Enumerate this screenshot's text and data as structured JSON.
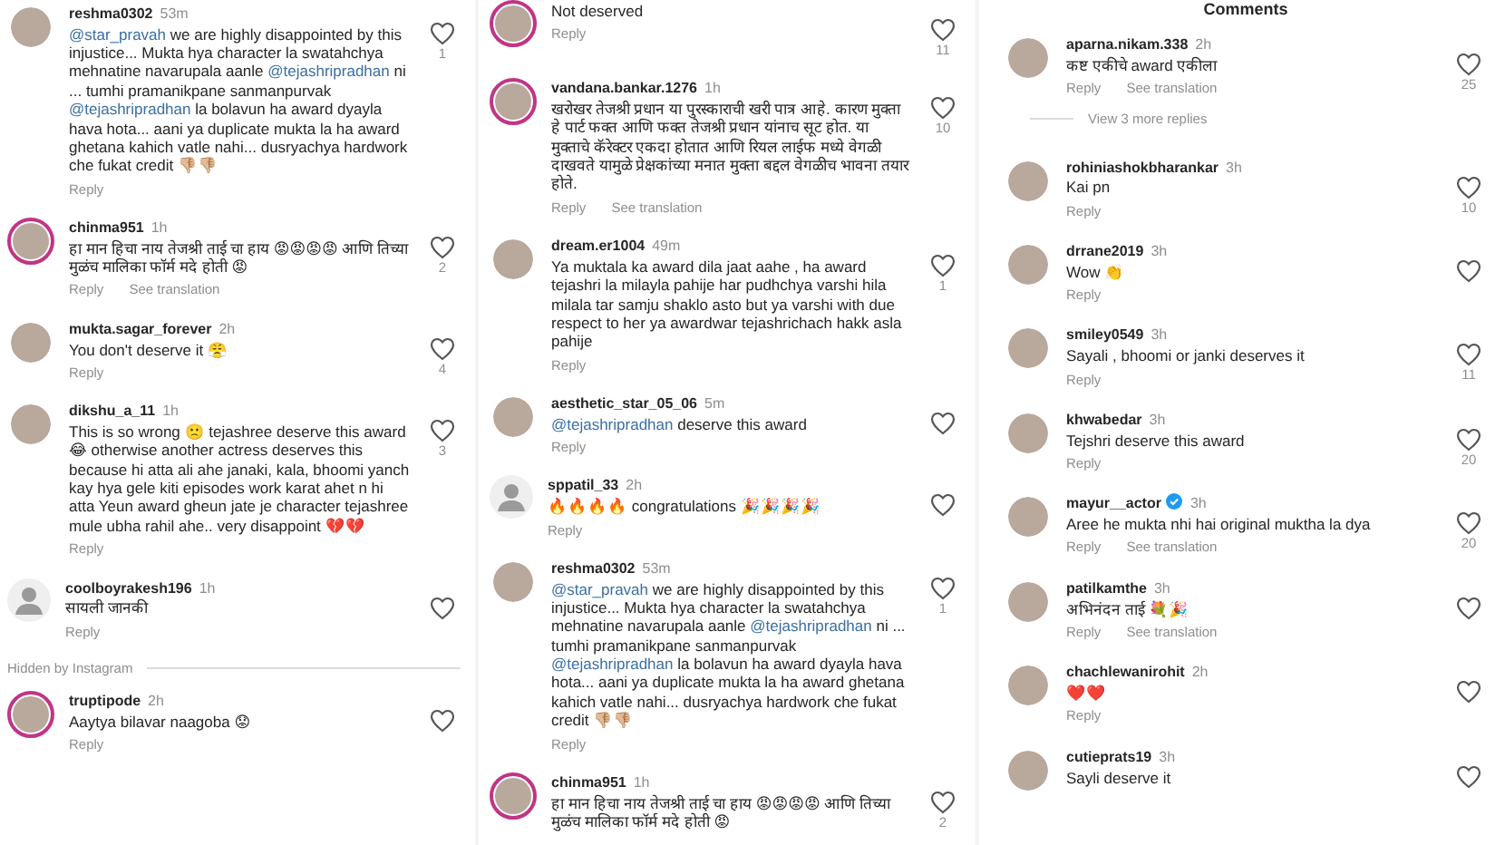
{
  "columns": [
    {
      "items": [
        {
          "kind": "comment",
          "username": "reshma0302",
          "time": "53m",
          "default_avatar": false,
          "story_ring": false,
          "verified": false,
          "segments": [
            {
              "kind": "mention",
              "text": "@star_pravah"
            },
            {
              "kind": "plain",
              "text": " we are highly disappointed by this injustice... Mukta hya character la swatahchya mehnatine navarupala aanle "
            },
            {
              "kind": "mention",
              "text": "@tejashripradhan"
            },
            {
              "kind": "plain",
              "text": " ni ... tumhi pramanikpane sanmanpurvak "
            },
            {
              "kind": "mention",
              "text": "@tejashripradhan"
            },
            {
              "kind": "plain",
              "text": " la bolavun ha award dyayla hava hota... aani ya duplicate mukta la ha award ghetana kahich vatle nahi... dusryachya hardwork che fukat credit 👎🏼👎🏼"
            }
          ],
          "actions": [
            "Reply"
          ],
          "likes": "1"
        },
        {
          "kind": "comment",
          "username": "chinma951",
          "time": "1h",
          "default_avatar": false,
          "story_ring": true,
          "verified": false,
          "segments": [
            {
              "kind": "plain",
              "text": "हा मान हिचा नाय तेजश्री ताई चा हाय 😡😡😡😡 आणि तिच्या मुळंच मालिका फॉर्म मदे होती 😡"
            }
          ],
          "actions": [
            "Reply",
            "See translation"
          ],
          "likes": "2"
        },
        {
          "kind": "comment",
          "username": "mukta.sagar_forever",
          "time": "2h",
          "default_avatar": false,
          "story_ring": false,
          "verified": false,
          "segments": [
            {
              "kind": "plain",
              "text": "You don't deserve it 😤"
            }
          ],
          "actions": [
            "Reply"
          ],
          "likes": "4"
        },
        {
          "kind": "comment",
          "username": "dikshu_a_11",
          "time": "1h",
          "default_avatar": false,
          "story_ring": false,
          "verified": false,
          "segments": [
            {
              "kind": "plain",
              "text": "This is so wrong 🙁 tejashree deserve this award😂 otherwise another actress deserves this because hi atta ali ahe janaki, kala, bhoomi yanch kay hya gele kiti episodes work karat ahet n hi atta Yeun award gheun jate je character tejashree mule ubha rahil ahe.. very disappoint 💔💔"
            }
          ],
          "actions": [
            "Reply"
          ],
          "likes": "3"
        },
        {
          "kind": "comment",
          "username": "coolboyrakesh196",
          "time": "1h",
          "default_avatar": true,
          "verified": false,
          "segments": [
            {
              "kind": "plain",
              "text": "सायली जानकी"
            }
          ],
          "actions": [
            "Reply"
          ]
        },
        {
          "kind": "divider",
          "text": "Hidden by Instagram"
        },
        {
          "kind": "comment",
          "username": "truptipode",
          "time": "2h",
          "default_avatar": false,
          "story_ring": true,
          "verified": false,
          "segments": [
            {
              "kind": "plain",
              "text": "Aaytya bilavar naagoba 😟"
            }
          ],
          "actions": [
            "Reply"
          ]
        }
      ]
    },
    {
      "items": [
        {
          "kind": "comment",
          "default_avatar": false,
          "story_ring": true,
          "verified": false,
          "segments": [
            {
              "kind": "plain",
              "text": "Not deserved"
            }
          ],
          "actions": [
            "Reply"
          ],
          "likes": "11"
        },
        {
          "kind": "comment",
          "username": "vandana.bankar.1276",
          "time": "1h",
          "default_avatar": false,
          "story_ring": true,
          "verified": false,
          "segments": [
            {
              "kind": "plain",
              "text": "खरोखर तेजश्री प्रधान या पुरस्काराची खरी पात्र आहे. कारण मुक्ता हे पार्ट फक्त आणि फक्त तेजश्री प्रधान यांनाच सूट होत. या मुक्ताचे कॅरेक्टर एकदा होतात आणि रियल लाईफ मध्ये वेगळी दाखवते यामुळे प्रेक्षकांच्या मनात मुक्ता बद्दल वेगळीच भावना तयार होते."
            }
          ],
          "actions": [
            "Reply",
            "See translation"
          ],
          "likes": "10"
        },
        {
          "kind": "comment",
          "username": "dream.er1004",
          "time": "49m",
          "default_avatar": false,
          "story_ring": false,
          "verified": false,
          "segments": [
            {
              "kind": "plain",
              "text": "Ya muktala ka award dila jaat aahe , ha award tejashri la milayla pahije har pudhchya varshi hila milala tar samju shaklo asto but ya varshi with due respect to her ya awardwar tejashrichach hakk asla pahije"
            }
          ],
          "actions": [
            "Reply"
          ],
          "likes": "1"
        },
        {
          "kind": "comment",
          "username": "aesthetic_star_05_06",
          "time": "5m",
          "default_avatar": false,
          "story_ring": false,
          "verified": false,
          "segments": [
            {
              "kind": "mention",
              "text": "@tejashripradhan"
            },
            {
              "kind": "plain",
              "text": " deserve this award"
            }
          ],
          "actions": [
            "Reply"
          ]
        },
        {
          "kind": "comment",
          "username": "sppatil_33",
          "time": "2h",
          "default_avatar": true,
          "verified": false,
          "segments": [
            {
              "kind": "plain",
              "text": "🔥🔥🔥🔥 congratulations 🎉🎉🎉🎉"
            }
          ],
          "actions": [
            "Reply"
          ]
        },
        {
          "kind": "comment",
          "username": "reshma0302",
          "time": "53m",
          "default_avatar": false,
          "story_ring": false,
          "verified": false,
          "segments": [
            {
              "kind": "mention",
              "text": "@star_pravah"
            },
            {
              "kind": "plain",
              "text": " we are highly disappointed by this injustice... Mukta hya character la swatahchya mehnatine navarupala aanle "
            },
            {
              "kind": "mention",
              "text": "@tejashripradhan"
            },
            {
              "kind": "plain",
              "text": " ni ... tumhi pramanikpane sanmanpurvak "
            },
            {
              "kind": "mention",
              "text": "@tejashripradhan"
            },
            {
              "kind": "plain",
              "text": " la bolavun ha award dyayla hava hota... aani ya duplicate mukta la ha award ghetana kahich vatle nahi... dusryachya hardwork che fukat credit 👎🏼👎🏼"
            }
          ],
          "actions": [
            "Reply"
          ],
          "likes": "1"
        },
        {
          "kind": "comment",
          "username": "chinma951",
          "time": "1h",
          "default_avatar": false,
          "story_ring": true,
          "verified": false,
          "segments": [
            {
              "kind": "plain",
              "text": "हा मान हिचा नाय तेजश्री ताई चा हाय 😡😡😡😡 आणि तिच्या मुळंच मालिका फॉर्म मदे होती 😡"
            }
          ],
          "likes": "2"
        }
      ]
    },
    {
      "title": "Comments",
      "items": [
        {
          "kind": "comment",
          "username": "aparna.nikam.338",
          "time": "2h",
          "default_avatar": false,
          "story_ring": false,
          "verified": false,
          "segments": [
            {
              "kind": "plain",
              "text": "कष्ट एकीचे award एकीला"
            }
          ],
          "actions": [
            "Reply",
            "See translation"
          ],
          "likes": "25"
        },
        {
          "kind": "more",
          "text": "View 3 more replies"
        },
        {
          "kind": "comment",
          "username": "rohiniashokbharankar",
          "time": "3h",
          "default_avatar": false,
          "story_ring": false,
          "verified": false,
          "segments": [
            {
              "kind": "plain",
              "text": "Kai pn"
            }
          ],
          "actions": [
            "Reply"
          ],
          "likes": "10"
        },
        {
          "kind": "comment",
          "username": "drrane2019",
          "time": "3h",
          "default_avatar": false,
          "story_ring": false,
          "verified": false,
          "segments": [
            {
              "kind": "plain",
              "text": "Wow 👏"
            }
          ],
          "actions": [
            "Reply"
          ]
        },
        {
          "kind": "comment",
          "username": "smiley0549",
          "time": "3h",
          "default_avatar": false,
          "story_ring": false,
          "verified": false,
          "segments": [
            {
              "kind": "plain",
              "text": "Sayali , bhoomi or janki deserves it"
            }
          ],
          "actions": [
            "Reply"
          ],
          "likes": "11"
        },
        {
          "kind": "comment",
          "username": "khwabedar",
          "time": "3h",
          "default_avatar": false,
          "story_ring": false,
          "verified": false,
          "segments": [
            {
              "kind": "plain",
              "text": "Tejshri deserve this award"
            }
          ],
          "actions": [
            "Reply"
          ],
          "likes": "20"
        },
        {
          "kind": "comment",
          "username": "mayur__actor",
          "time": "3h",
          "default_avatar": false,
          "story_ring": false,
          "verified": true,
          "segments": [
            {
              "kind": "plain",
              "text": "Aree he mukta nhi hai original muktha la dya"
            }
          ],
          "actions": [
            "Reply",
            "See translation"
          ],
          "likes": "20"
        },
        {
          "kind": "comment",
          "username": "patilkamthe",
          "time": "3h",
          "default_avatar": false,
          "story_ring": false,
          "verified": false,
          "segments": [
            {
              "kind": "plain",
              "text": "अभिनंदन ताई 💐🎉"
            }
          ],
          "actions": [
            "Reply",
            "See translation"
          ]
        },
        {
          "kind": "comment",
          "username": "chachlewanirohit",
          "time": "2h",
          "default_avatar": false,
          "story_ring": false,
          "verified": false,
          "segments": [
            {
              "kind": "plain",
              "text": "❤️❤️"
            }
          ],
          "actions": [
            "Reply"
          ]
        },
        {
          "kind": "comment",
          "username": "cutieprats19",
          "time": "3h",
          "default_avatar": false,
          "story_ring": false,
          "verified": false,
          "segments": [
            {
              "kind": "plain",
              "text": "Sayli deserve it"
            }
          ]
        }
      ]
    }
  ]
}
